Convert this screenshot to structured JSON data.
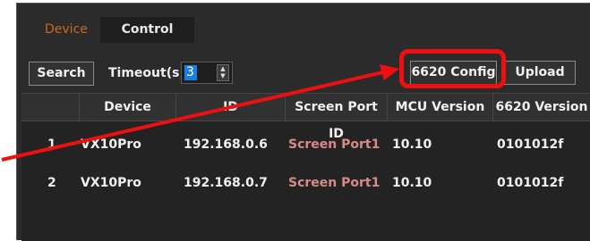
{
  "tabs": [
    {
      "label": "Device",
      "active": false
    },
    {
      "label": "Control",
      "active": true
    }
  ],
  "toolbar": {
    "search_label": "Search",
    "timeout_label": "Timeout(s)",
    "timeout_value": "3",
    "config_label": "6620 Config",
    "upload_label": "Upload"
  },
  "table": {
    "columns": [
      "",
      "Device",
      "ID",
      "Screen Port ID",
      "MCU Version",
      "6620 Version"
    ],
    "rows": [
      [
        "1",
        "VX10Pro",
        "192.168.0.6",
        "Screen Port1",
        "10.10",
        "0101012f"
      ],
      [
        "2",
        "VX10Pro",
        "192.168.0.7",
        "Screen Port1",
        "10.10",
        "0101012f"
      ]
    ]
  },
  "colors": {
    "panel_bg": "#2b2b2b",
    "accent_tab": "#c7691e",
    "selection": "#1a7fe0",
    "annotation_red": "#ee1010",
    "port_text": "#d88a8a"
  }
}
